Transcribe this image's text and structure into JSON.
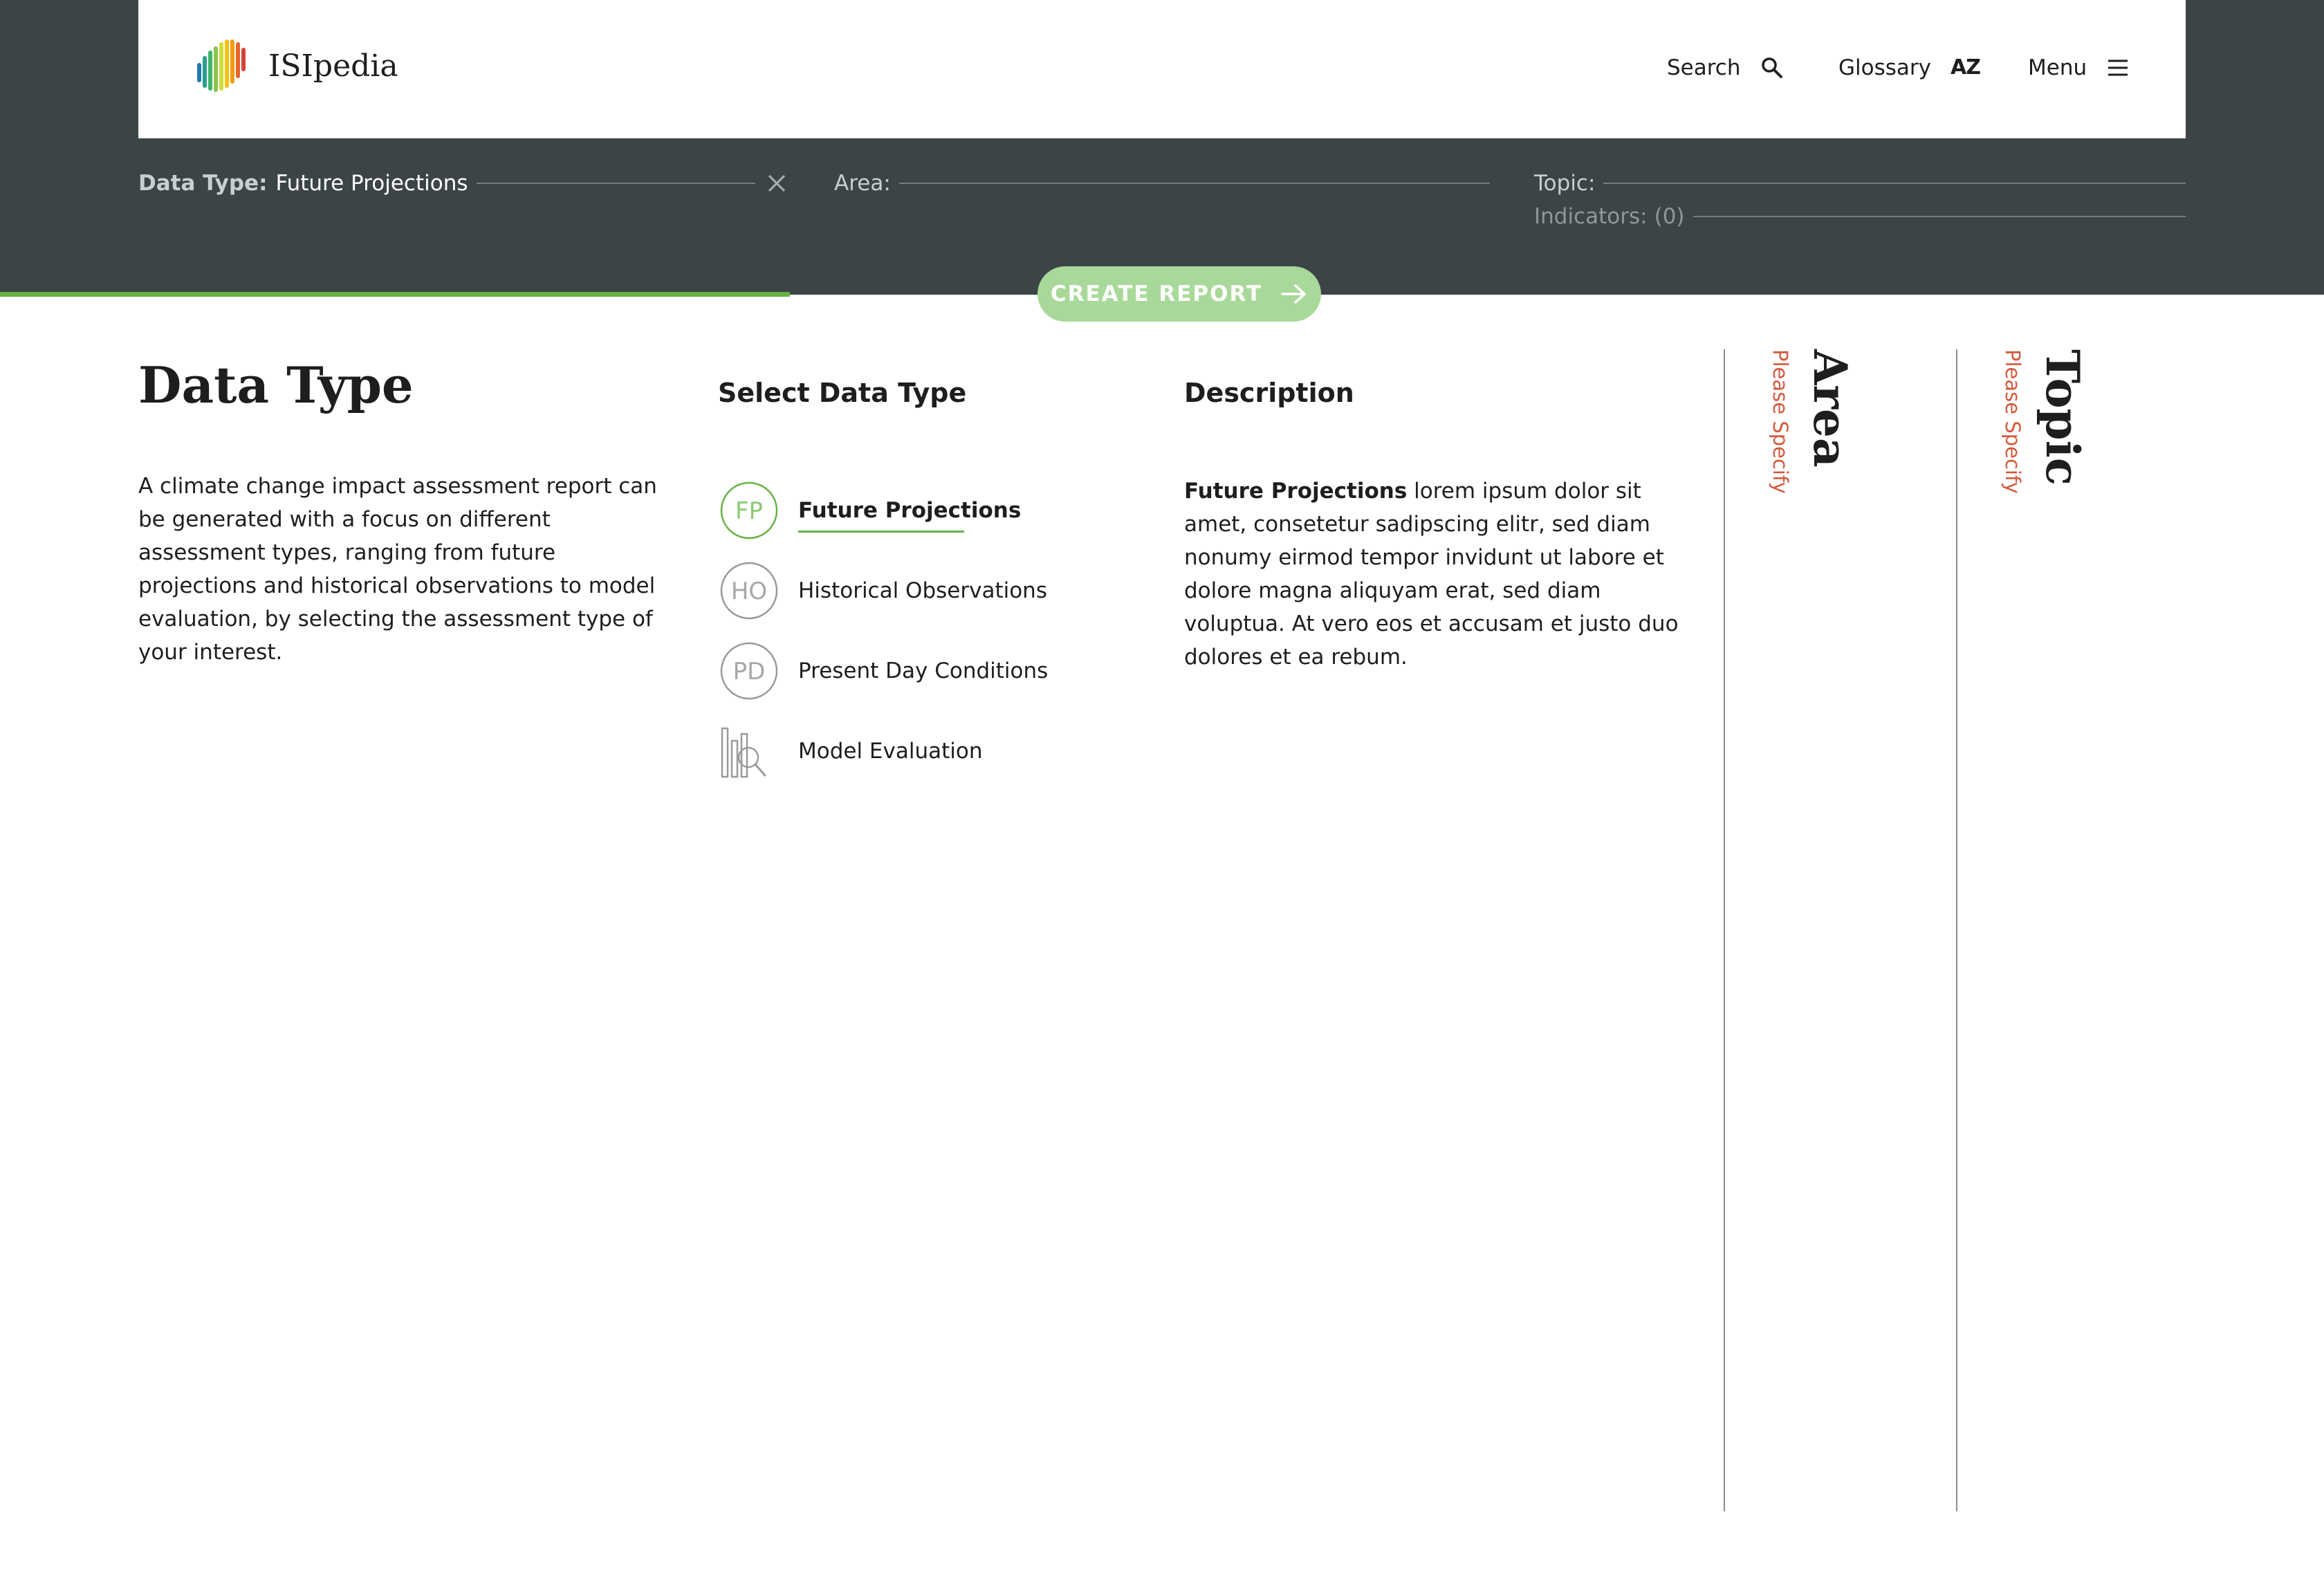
{
  "header": {
    "brand": "ISIpedia",
    "nav": {
      "search": "Search",
      "glossary": "Glossary",
      "glossary_icon": "AZ",
      "menu": "Menu"
    }
  },
  "filters": {
    "data_type_label": "Data Type:",
    "data_type_value": "Future Projections",
    "area_label": "Area:",
    "topic_label": "Topic:",
    "indicators_label": "Indicators:",
    "indicators_count": "(0)"
  },
  "cta": {
    "label": "CREATE REPORT"
  },
  "colors": {
    "dark_band": "#3c4446",
    "accent_green": "#66b244",
    "cta_green": "#a9d99a",
    "hint_red": "#d4593e"
  },
  "main": {
    "title": "Data Type",
    "intro": "A climate change impact assessment report can be generated with a focus on different assessment types, ranging from future projections and historical observations to model evaluation, by selecting the assessment type of your interest.",
    "select_heading": "Select Data Type",
    "data_types": [
      {
        "abbr": "FP",
        "label": "Future Projections",
        "selected": true,
        "icon": "fp-circle-icon"
      },
      {
        "abbr": "HO",
        "label": "Historical Observations",
        "selected": false,
        "icon": "ho-circle-icon"
      },
      {
        "abbr": "PD",
        "label": "Present Day Conditions",
        "selected": false,
        "icon": "pd-circle-icon"
      },
      {
        "abbr": "",
        "label": "Model Evaluation",
        "selected": false,
        "icon": "model-evaluation-icon"
      }
    ],
    "description_heading": "Description",
    "description_bold": "Future Projections",
    "description_text": " lorem ipsum dolor sit amet, consetetur sadipscing elitr, sed diam nonumy eirmod tempor invidunt ut labore et dolore magna aliquyam erat, sed diam voluptua. At vero eos et accusam et justo duo dolores et ea rebum."
  },
  "side_panels": {
    "area": {
      "title": "Area",
      "hint": "Please Specify"
    },
    "topic": {
      "title": "Topic",
      "hint": "Please Specify"
    }
  }
}
